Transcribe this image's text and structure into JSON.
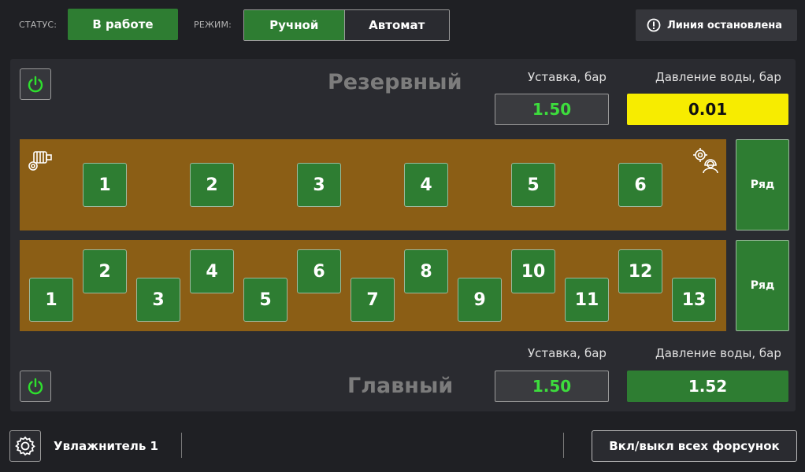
{
  "header": {
    "status_label": "СТАТУС:",
    "status_value": "В работе",
    "mode_label": "РЕЖИМ:",
    "mode_manual": "Ручной",
    "mode_auto": "Автомат",
    "line_status": "Линия остановлена"
  },
  "reserve": {
    "title": "Резервный",
    "setpoint_label": "Уставка, бар",
    "setpoint_value": "1.50",
    "pressure_label": "Давление воды, бар",
    "pressure_value": "0.01",
    "nozzles": [
      "1",
      "2",
      "3",
      "4",
      "5",
      "6"
    ],
    "row_label": "Ряд"
  },
  "main": {
    "title": "Главный",
    "setpoint_label": "Уставка, бар",
    "setpoint_value": "1.50",
    "pressure_label": "Давление воды, бар",
    "pressure_value": "1.52",
    "nozzles": [
      "1",
      "2",
      "3",
      "4",
      "5",
      "6",
      "7",
      "8",
      "9",
      "10",
      "11",
      "12",
      "13"
    ],
    "row_label": "Ряд"
  },
  "footer": {
    "device_name": "Увлажнитель 1",
    "toggle_all": "Вкл/выкл всех форсунок"
  },
  "colors": {
    "accent_green": "#2e7d32",
    "warning_yellow": "#f7ec00",
    "strip_brown": "#8b5e15",
    "setpoint_text": "#3ddc3d"
  },
  "icons": [
    "power-icon",
    "motor-icon",
    "gear-worker-icon",
    "settings-gear-icon",
    "alert-circle-icon"
  ]
}
